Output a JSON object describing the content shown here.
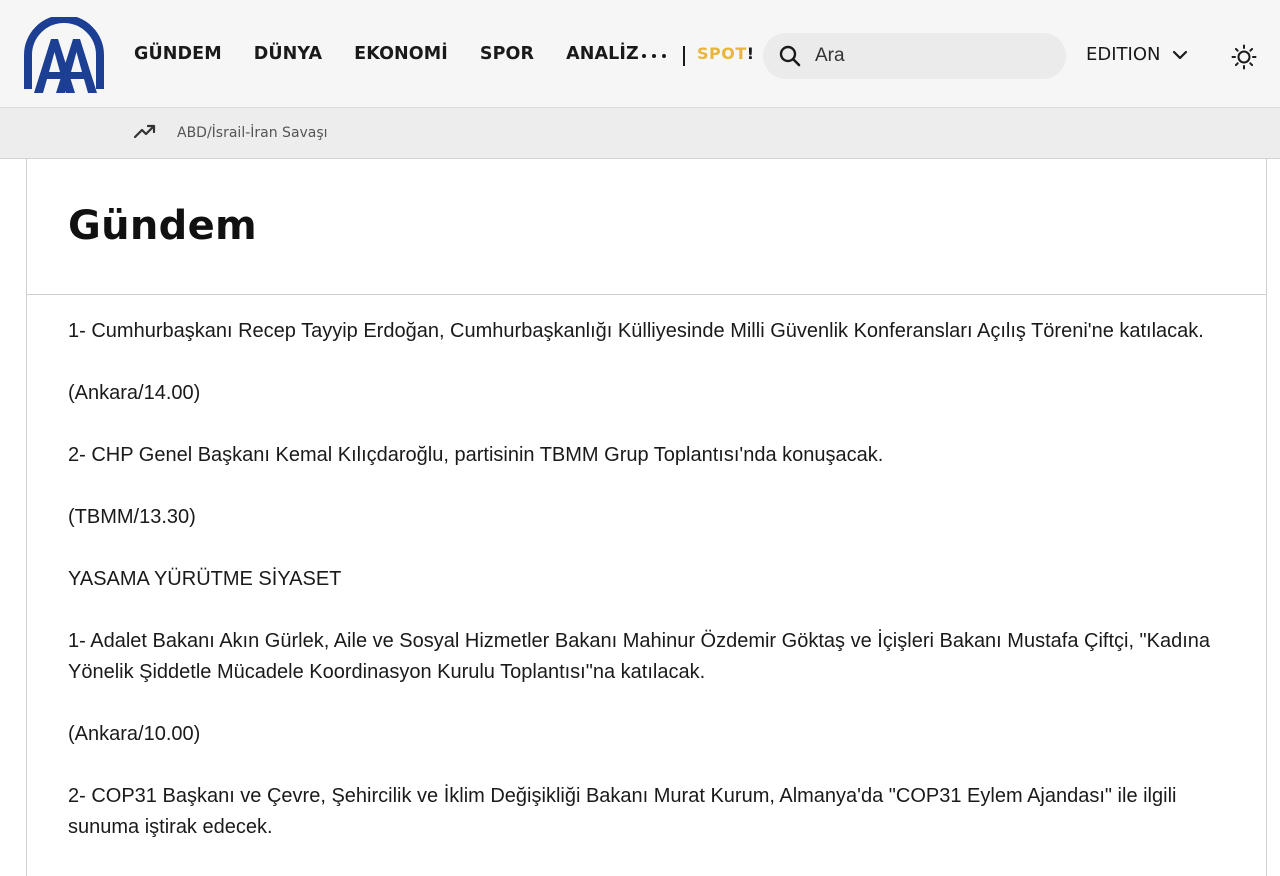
{
  "header": {
    "logo_text": "AA",
    "nav": [
      "GÜNDEM",
      "DÜNYA",
      "EKONOMİ",
      "SPOR",
      "ANALİZ"
    ],
    "more_icon": "ellipsis-icon",
    "spot_label": "SPOT",
    "spot_bang": "!",
    "spot_color": "#e8b73a",
    "search_placeholder": "Ara",
    "edition_label": "EDITION",
    "theme_icon": "sun-icon"
  },
  "trending": {
    "icon": "trending-up-icon",
    "label": "ABD/İsrail-İran Savaşı"
  },
  "main": {
    "title": "Gündem",
    "paragraphs": [
      "1- Cumhurbaşkanı Recep Tayyip Erdoğan, Cumhurbaşkanlığı Külliyesinde Milli Güvenlik Konferansları Açılış Töreni'ne katılacak.",
      "(Ankara/14.00)",
      "2- CHP Genel Başkanı Kemal Kılıçdaroğlu, partisinin TBMM Grup Toplantısı'nda konuşacak.",
      "(TBMM/13.30)",
      "YASAMA YÜRÜTME SİYASET",
      "1- Adalet Bakanı Akın Gürlek, Aile ve Sosyal Hizmetler Bakanı Mahinur Özdemir Göktaş ve İçişleri Bakanı Mustafa Çiftçi, \"Kadına Yönelik Şiddetle Mücadele Koordinasyon Kurulu Toplantısı\"na katılacak.",
      "(Ankara/10.00)",
      "2- COP31 Başkanı ve Çevre, Şehircilik ve İklim Değişikliği Bakanı Murat Kurum, Almanya'da \"COP31 Eylem Ajandası\" ile ilgili sunuma iştirak edecek."
    ]
  },
  "colors": {
    "brand_blue": "#1c3f94",
    "header_bg": "#f6f6f6",
    "trend_bg": "#ededed"
  }
}
